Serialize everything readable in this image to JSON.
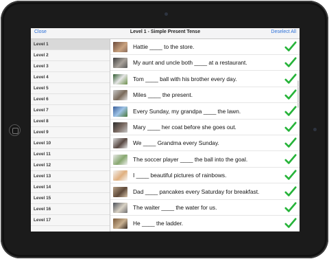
{
  "header": {
    "close_label": "Close",
    "title": "Level 1 - Simple Present Tense",
    "deselect_label": "Deselect All"
  },
  "levels": [
    "Level 1",
    "Level 2",
    "Level 3",
    "Level 4",
    "Level 5",
    "Level 6",
    "Level 7",
    "Level 8",
    "Level 9",
    "Level 10",
    "Level 11",
    "Level 12",
    "Level 13",
    "Level 14",
    "Level 15",
    "Level 16",
    "Level 17"
  ],
  "selected_level_index": 0,
  "sentences": [
    "Hattie ____ to the store.",
    "My aunt and uncle both ____ at a restaurant.",
    "Tom ____ ball with his brother every day.",
    "Miles ____ the present.",
    "Every Sunday, my grandpa ____ the lawn.",
    "Mary ____ her coat before she goes out.",
    "We ____ Grandma every Sunday.",
    "The soccer player ____ the ball into the goal.",
    "I ____ beautiful pictures of rainbows.",
    "Dad ____ pancakes every Saturday for breakfast.",
    "The waiter ____ the water for us.",
    "He ____ the ladder."
  ],
  "colors": {
    "accent_blue": "#2a6fd8",
    "check_green": "#27b43a"
  }
}
